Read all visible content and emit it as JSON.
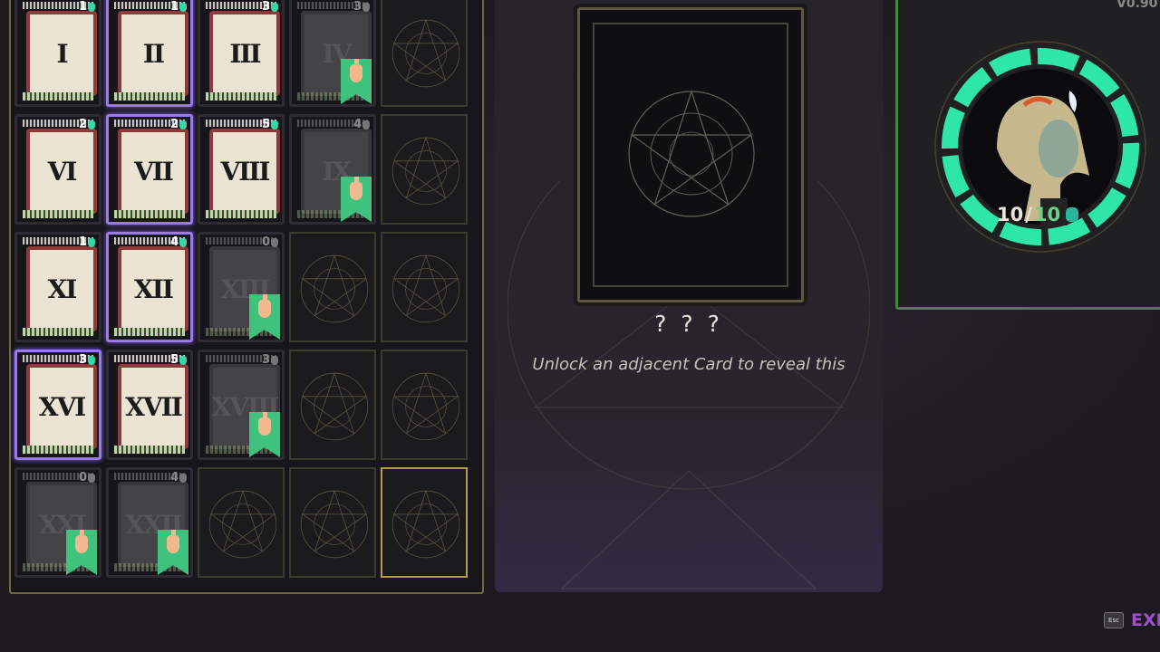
{
  "version": "V0.90",
  "grid": {
    "rows": [
      [
        {
          "type": "card",
          "numeral": "I",
          "cost": "1",
          "rare": false,
          "locked": false
        },
        {
          "type": "card",
          "numeral": "II",
          "cost": "1",
          "rare": true,
          "locked": false
        },
        {
          "type": "card",
          "numeral": "III",
          "cost": "3",
          "rare": false,
          "locked": false
        },
        {
          "type": "card",
          "numeral": "IV",
          "cost": "3",
          "rare": false,
          "locked": true
        },
        {
          "type": "empty"
        }
      ],
      [
        {
          "type": "card",
          "numeral": "VI",
          "cost": "2",
          "rare": false,
          "locked": false
        },
        {
          "type": "card",
          "numeral": "VII",
          "cost": "2",
          "rare": true,
          "locked": false
        },
        {
          "type": "card",
          "numeral": "VIII",
          "cost": "5",
          "rare": false,
          "locked": false
        },
        {
          "type": "card",
          "numeral": "IX",
          "cost": "4",
          "rare": false,
          "locked": true
        },
        {
          "type": "empty"
        }
      ],
      [
        {
          "type": "card",
          "numeral": "XI",
          "cost": "1",
          "rare": false,
          "locked": false
        },
        {
          "type": "card",
          "numeral": "XII",
          "cost": "4",
          "rare": true,
          "locked": false
        },
        {
          "type": "card",
          "numeral": "XIII",
          "cost": "0",
          "rare": false,
          "locked": true
        },
        {
          "type": "empty"
        },
        {
          "type": "empty"
        }
      ],
      [
        {
          "type": "card",
          "numeral": "XVI",
          "cost": "3",
          "rare": true,
          "locked": false
        },
        {
          "type": "card",
          "numeral": "XVII",
          "cost": "5",
          "rare": false,
          "locked": false
        },
        {
          "type": "card",
          "numeral": "XVIII",
          "cost": "3",
          "rare": false,
          "locked": true
        },
        {
          "type": "empty"
        },
        {
          "type": "empty"
        }
      ],
      [
        {
          "type": "card",
          "numeral": "XXI",
          "cost": "0",
          "rare": false,
          "locked": true
        },
        {
          "type": "card",
          "numeral": "XXII",
          "cost": "4",
          "rare": false,
          "locked": true
        },
        {
          "type": "empty"
        },
        {
          "type": "empty"
        },
        {
          "type": "empty",
          "highlighted": true
        }
      ]
    ]
  },
  "detail": {
    "title": "? ? ?",
    "description": "Unlock an adjacent Card to reveal this"
  },
  "player": {
    "hp_current": "10",
    "hp_separator": "/",
    "hp_max": "10"
  },
  "footer": {
    "esc_key": "Esc",
    "exit_label": "EXIT"
  },
  "colors": {
    "accent_green": "#38d7a6",
    "rare_purple": "#9a7ae8",
    "exit_purple": "#a14fd2"
  }
}
